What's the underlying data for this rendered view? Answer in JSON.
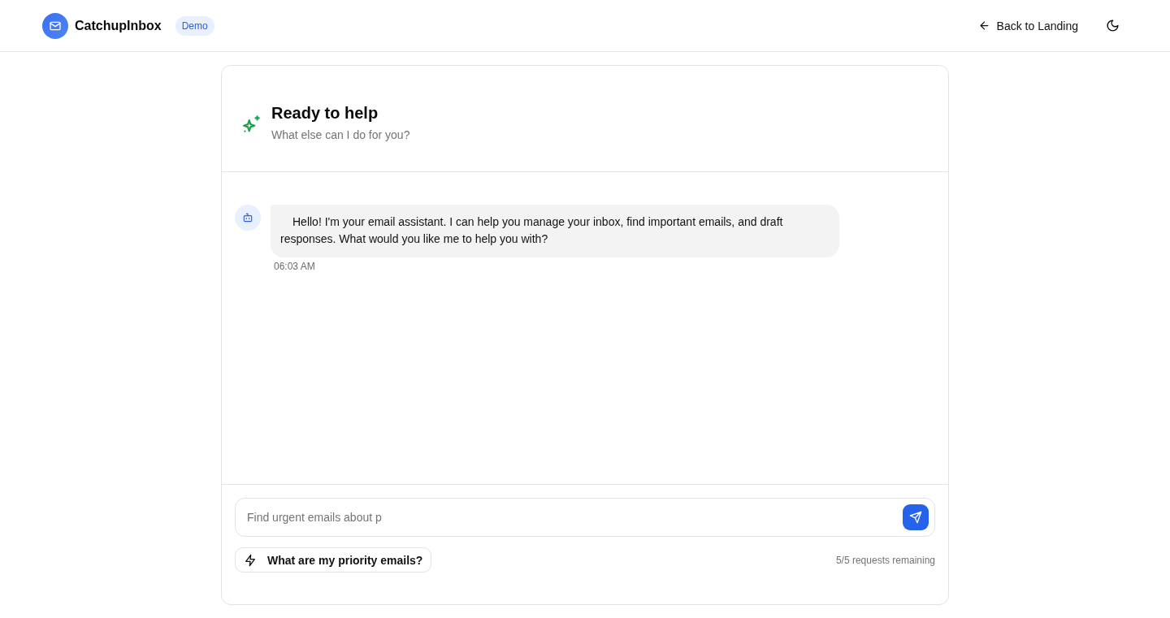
{
  "header": {
    "brand": "CatchupInbox",
    "badge": "Demo",
    "back_link": "Back to Landing"
  },
  "assistant": {
    "title": "Ready to help",
    "subtitle": "What else can I do for you?"
  },
  "messages": [
    {
      "kind": "assistant",
      "text": "Hello! I'm your email assistant. I can help you manage your inbox, find important emails, and draft responses. What would you like me to help you with?",
      "time": "06:03 AM"
    }
  ],
  "composer": {
    "placeholder": "Find urgent emails about p",
    "suggestions": [
      "What are my priority emails?"
    ],
    "quota": "5/5 requests remaining"
  }
}
